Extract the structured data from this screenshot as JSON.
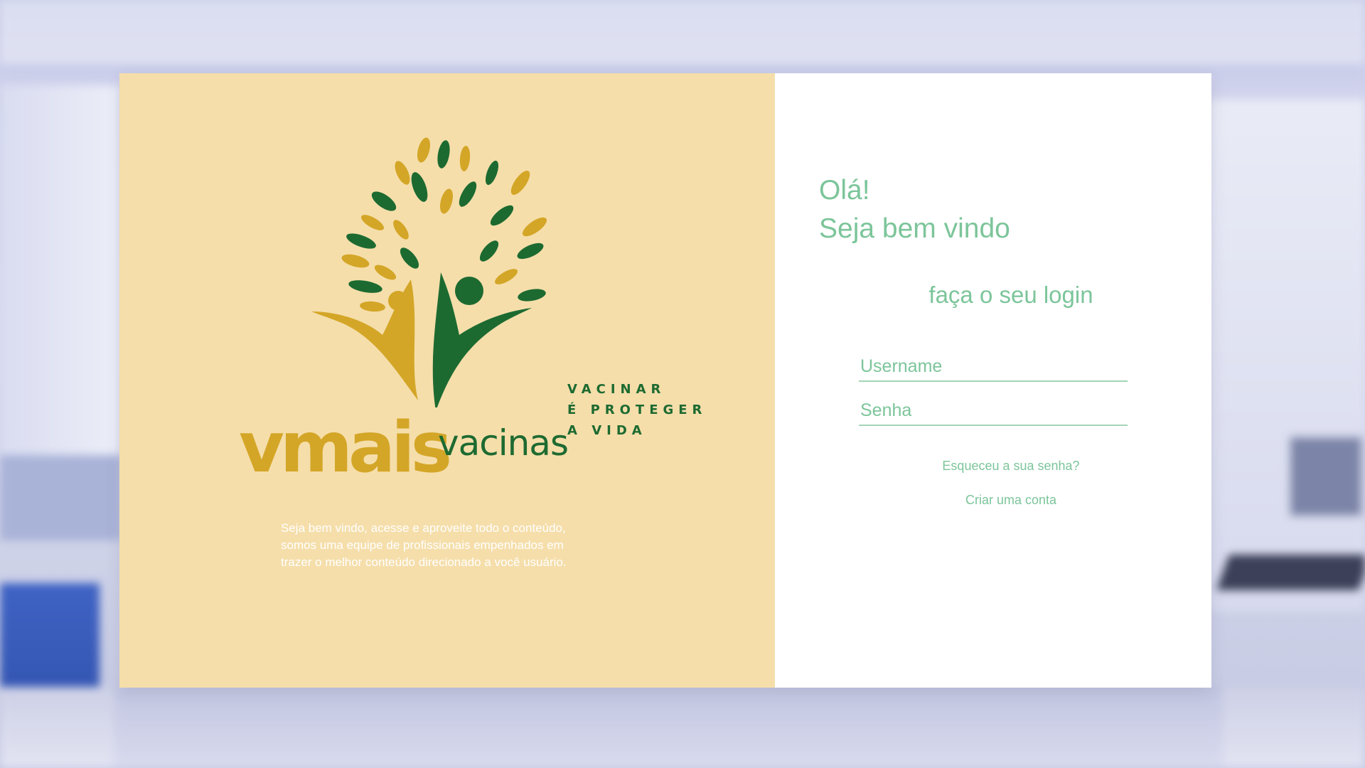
{
  "brand": {
    "name_main": "vmais",
    "name_sub": "vacinas",
    "tagline": [
      "VACINAR",
      "É PROTEGER",
      "A VIDA"
    ],
    "colors": {
      "gold": "#d4a627",
      "green": "#1d6a31",
      "panel": "#f5deaa"
    }
  },
  "intro": {
    "lines": [
      "Seja bem vindo, acesse e aproveite todo o conteúdo,",
      "somos uma equipe de profissionais empenhados em",
      "trazer o melhor conteúdo direcionado a você usuário."
    ]
  },
  "login": {
    "greeting_line1": "Olá!",
    "greeting_line2": "Seja bem vindo",
    "subtitle": "faça o seu login",
    "username_placeholder": "Username",
    "password_placeholder": "Senha",
    "forgot_link": "Esqueceu a sua senha?",
    "create_link": "Criar uma conta",
    "accent": "#7cc59a"
  },
  "icons": {
    "logo": "tree-people-logo-icon"
  }
}
